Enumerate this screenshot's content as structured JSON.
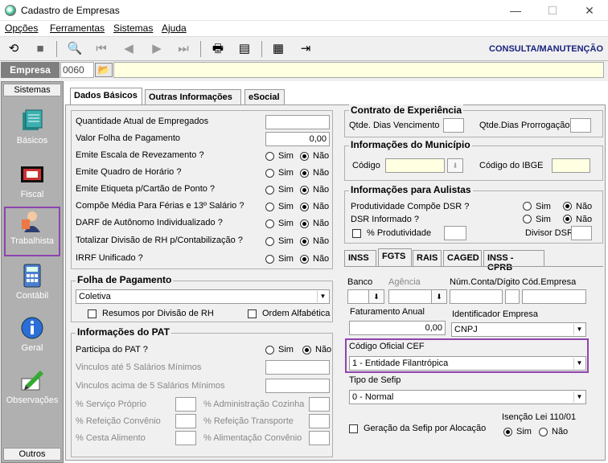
{
  "window": {
    "title": "Cadastro de Empresas",
    "min": "—",
    "max": "☐",
    "close": "✕"
  },
  "menu": [
    "Opções",
    "Ferramentas",
    "Sistemas",
    "Ajuda"
  ],
  "toolbar": {
    "mode": "CONSULTA/MANUTENÇÃO"
  },
  "empresa": {
    "label": "Empresa",
    "code": "0060",
    "name": ""
  },
  "sidebar": {
    "top": "Sistemas",
    "bottom": "Outros",
    "items": [
      "Básicos",
      "Fiscal",
      "Trabalhista",
      "Contábil",
      "Geral",
      "Observações"
    ]
  },
  "tabs": [
    "Dados Básicos",
    "Outras Informações",
    "eSocial"
  ],
  "basic": {
    "rows": [
      "Quantidade Atual de Empregados",
      "Valor Folha de Pagamento",
      "Emite Escala de Revezamento ?",
      "Emite Quadro de Horário ?",
      "Emite Etiqueta p/Cartão de Ponto ?",
      "Compõe Média Para Férias e 13º Salário ?",
      "DARF de Autônomo Individualizado ?",
      "Totalizar Divisão de RH p/Contabilização ?",
      "IRRF Unificado ?"
    ],
    "valor_folha": "0,00",
    "sim": "Sim",
    "nao": "Não"
  },
  "folha": {
    "title": "Folha de Pagamento",
    "value": "Coletiva",
    "resumos": "Resumos por Divisão de RH",
    "ordem": "Ordem Alfabética"
  },
  "pat": {
    "title": "Informações do PAT",
    "participa": "Participa do PAT ?",
    "vinc_ate": "Vinculos até 5 Salários Mínimos",
    "vinc_acima": "Vinculos acima de 5 Salários Mínimos",
    "servico": "% Serviço Próprio",
    "refeicao_conv": "% Refeição Convênio",
    "cesta": "% Cesta Alimento",
    "admin": "% Administração Cozinha",
    "refeicao_transp": "% Refeição Transporte",
    "alimentacao": "% Alimentação Convênio"
  },
  "contrato": {
    "title": "Contrato de Experiência",
    "venc": "Qtde. Dias Vencimento",
    "prorrog": "Qtde.Dias Prorrogação"
  },
  "municipio": {
    "title": "Informações do Município",
    "codigo": "Código",
    "ibge": "Código do IBGE"
  },
  "aulistas": {
    "title": "Informações para Aulistas",
    "produtividade": "Produtividade Compõe DSR ?",
    "dsr": "DSR Informado ?",
    "perc": "% Produtividade",
    "divisor": "Divisor DSR"
  },
  "subtabs": [
    "INSS",
    "FGTS",
    "RAIS",
    "CAGED",
    "INSS - CPRB"
  ],
  "fgts": {
    "banco": "Banco",
    "agencia": "Agência",
    "conta": "Núm.Conta/Dígito",
    "cod_empresa": "Cód.Empresa",
    "faturamento": "Faturamento Anual",
    "faturamento_val": "0,00",
    "identificador": "Identificador Empresa",
    "identificador_val": "CNPJ",
    "codigo_cef": "Código Oficial CEF",
    "codigo_cef_val": "1 - Entidade Filantrópica",
    "sefip": "Tipo de Sefip",
    "sefip_val": "0 - Normal",
    "geracao": "Geração da Sefip por Alocação",
    "isencao": "Isenção Lei 110/01"
  },
  "colors": {
    "accent": "#8e44ad",
    "mode": "#1a237e"
  }
}
